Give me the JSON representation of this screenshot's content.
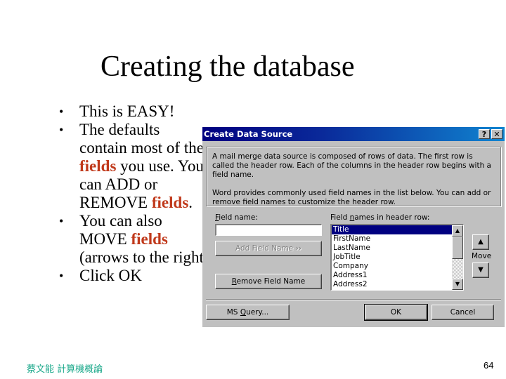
{
  "slide": {
    "title": "Creating the database",
    "bullets": [
      {
        "parts": [
          {
            "text": "This is EASY!"
          }
        ]
      },
      {
        "parts": [
          {
            "text": "The defaults contain most of the "
          },
          {
            "text": "fields",
            "highlight": true
          },
          {
            "text": " you use. You can ADD or REMOVE "
          },
          {
            "text": "fields",
            "highlight": true
          },
          {
            "text": "."
          }
        ]
      },
      {
        "parts": [
          {
            "text": "You can also MOVE "
          },
          {
            "text": "fields",
            "highlight": true
          },
          {
            "text": " (arrows to the right)"
          }
        ]
      },
      {
        "parts": [
          {
            "text": "Click OK"
          }
        ]
      }
    ],
    "bullet_glyph": "•",
    "highlight_color": "#c0391b",
    "footer_author": "蔡文能 計算機概論",
    "page_number": "64"
  },
  "dialog": {
    "title": "Create Data Source",
    "help_button": "?",
    "close_button": "✕",
    "info_paragraph_1": "A mail merge data source is composed of rows of data. The first row is called the header row. Each of the columns in the header row begins with a field name.",
    "info_paragraph_2": "Word provides commonly used field names in the list below. You can add or remove field names to customize the header row.",
    "field_name_label": {
      "mnemonic": "F",
      "rest": "ield name:"
    },
    "field_name_value": "",
    "add_field_button": "Add Field Name  ››",
    "remove_field_button": {
      "mnemonic": "R",
      "rest": "emove Field Name"
    },
    "header_list_label": {
      "pre": "Field ",
      "mnemonic": "n",
      "rest": "ames in header row:"
    },
    "header_fields": [
      "Title",
      "FirstName",
      "LastName",
      "JobTitle",
      "Company",
      "Address1",
      "Address2"
    ],
    "selected_field": "Title",
    "move_label": "Move",
    "move_up_icon": "▲",
    "move_down_icon": "▼",
    "ms_query_button": {
      "pre": "MS ",
      "mnemonic": "Q",
      "rest": "uery..."
    },
    "ok_button": "OK",
    "cancel_button": "Cancel",
    "colors": {
      "titlebar_start": "#000080",
      "titlebar_end": "#1084d0",
      "face": "#c0c0c0",
      "selection": "#000080"
    }
  }
}
